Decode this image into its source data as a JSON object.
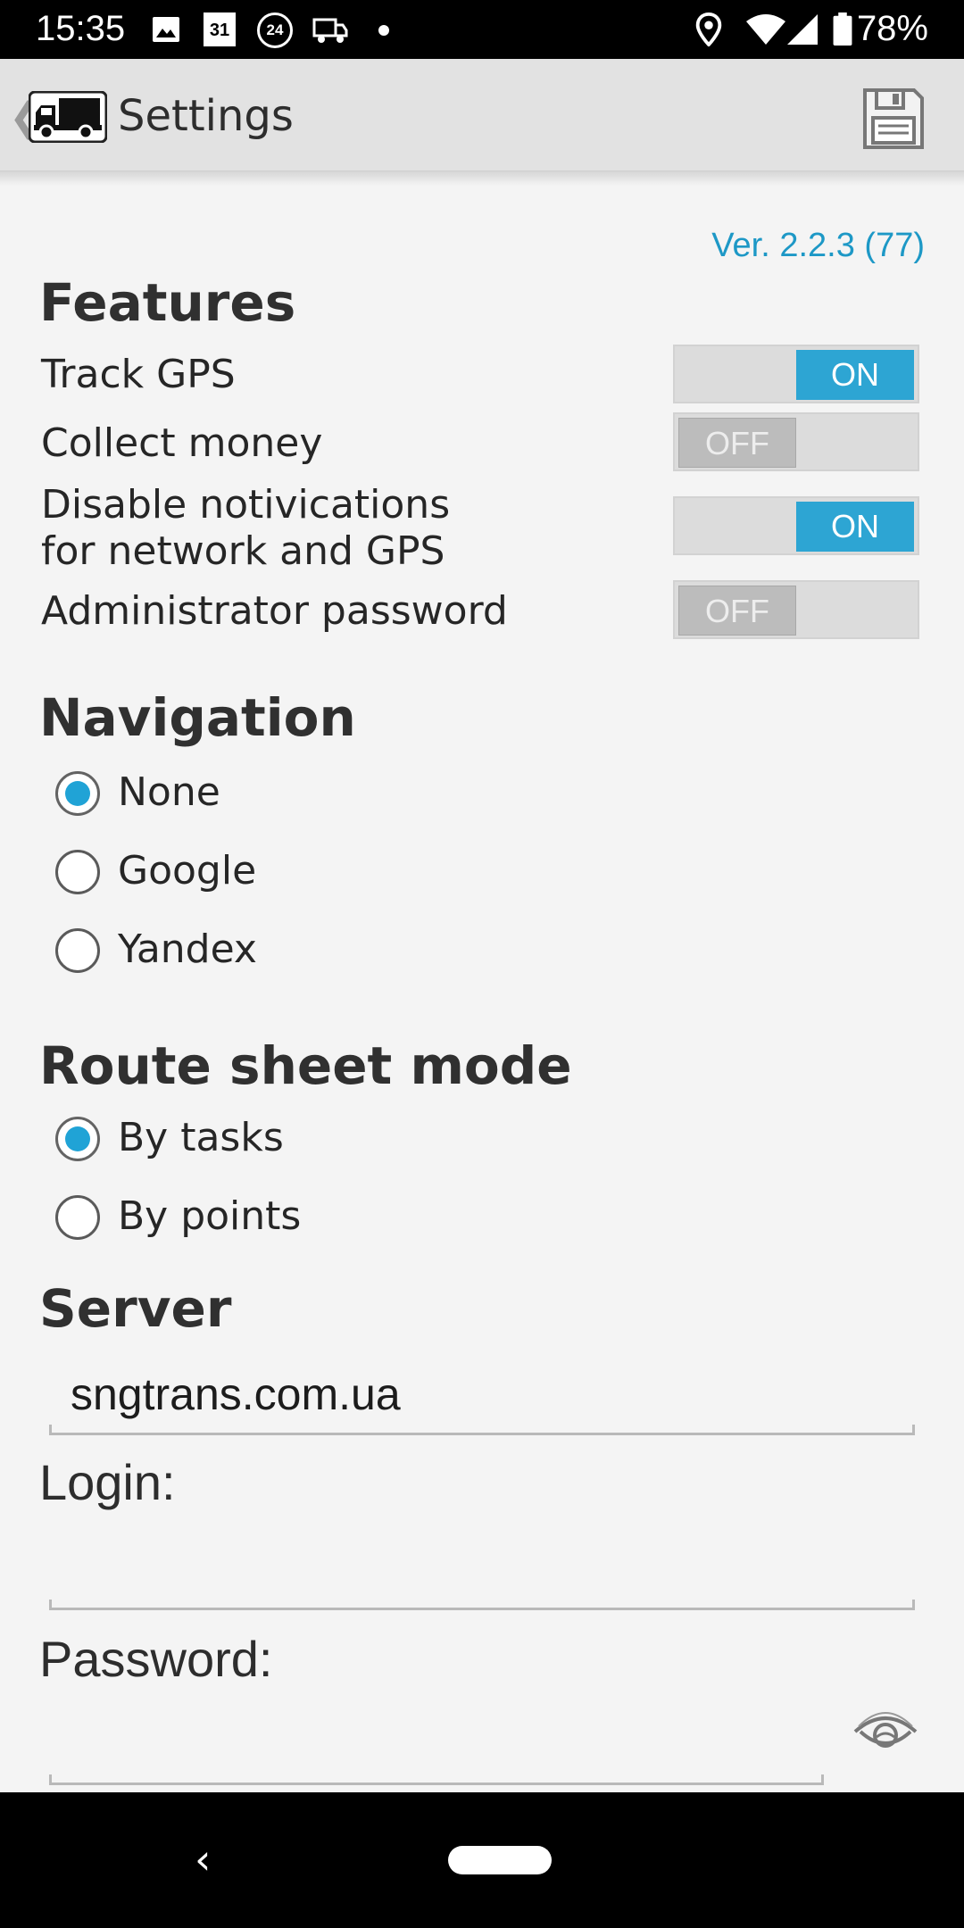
{
  "status_bar": {
    "time": "15:35",
    "calendar_day": "31",
    "badge_24": "24",
    "battery_percent": "78%",
    "icons": [
      "image-icon",
      "calendar-icon",
      "24-badge-icon",
      "truck-icon",
      "dot-icon",
      "location-icon",
      "wifi-icon",
      "signal-icon",
      "battery-icon"
    ]
  },
  "app_bar": {
    "back_glyph": "❮",
    "title": "Settings",
    "logo_icon": "truck-icon",
    "save_icon": "floppy-disk-icon"
  },
  "version": "Ver. 2.2.3 (77)",
  "features": {
    "title": "Features",
    "items": [
      {
        "label": "Track GPS",
        "state": "ON"
      },
      {
        "label": "Collect money",
        "state": "OFF"
      },
      {
        "label_line1": "Disable notivications",
        "label_line2": "for network and GPS",
        "state": "ON"
      },
      {
        "label": "Administrator password",
        "state": "OFF"
      }
    ]
  },
  "navigation": {
    "title": "Navigation",
    "options": [
      "None",
      "Google",
      "Yandex"
    ],
    "selected": "None"
  },
  "route_sheet": {
    "title": "Route sheet mode",
    "options": [
      "By tasks",
      "By points"
    ],
    "selected": "By tasks"
  },
  "server": {
    "title": "Server",
    "value": "sngtrans.com.ua"
  },
  "login": {
    "label": "Login:",
    "value": ""
  },
  "password": {
    "label": "Password:",
    "value": "",
    "reveal_icon": "eye-icon"
  },
  "nav_bar": {
    "back_glyph": "‹"
  },
  "colors": {
    "accent": "#2da5d3",
    "version_text": "#1d98c6",
    "radio_fill": "#20a3d6"
  }
}
